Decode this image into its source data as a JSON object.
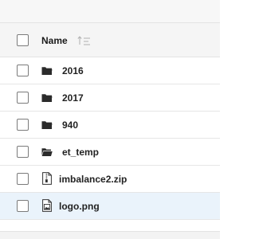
{
  "header": {
    "name_label": "Name"
  },
  "rows": [
    {
      "label": "2016",
      "icon": "folder-icon",
      "selected": false
    },
    {
      "label": "2017",
      "icon": "folder-icon",
      "selected": false
    },
    {
      "label": "940",
      "icon": "folder-icon",
      "selected": false
    },
    {
      "label": "et_temp",
      "icon": "folder-open-icon",
      "selected": false
    },
    {
      "label": "imbalance2.zip",
      "icon": "zip-file-icon",
      "selected": false
    },
    {
      "label": "logo.png",
      "icon": "image-file-icon",
      "selected": true
    }
  ],
  "colors": {
    "selected_row_bg": "#eaf3fb",
    "header_bg": "#f5f5f5",
    "row_border": "#e6e6e6"
  }
}
